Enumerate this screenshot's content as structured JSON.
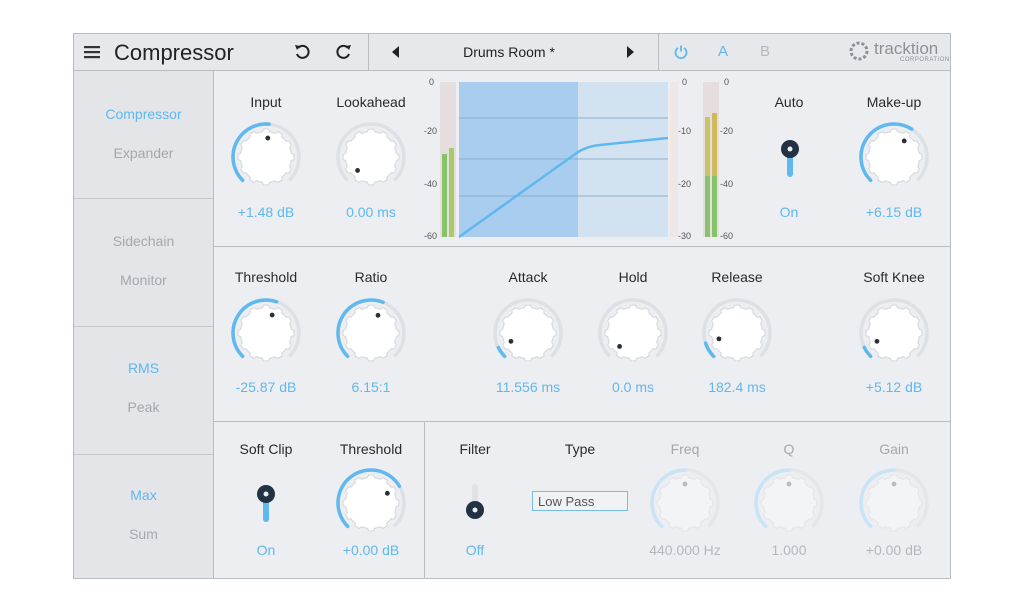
{
  "header": {
    "title": "Compressor",
    "preset": "Drums Room *",
    "ab_a": "A",
    "ab_b": "B",
    "brand": "tracktion",
    "brand_sub": "CORPORATION"
  },
  "sidebar": {
    "groups": [
      [
        {
          "label": "Compressor",
          "active": true
        },
        {
          "label": "Expander",
          "active": false
        }
      ],
      [
        {
          "label": "Sidechain",
          "active": false
        },
        {
          "label": "Monitor",
          "active": false
        }
      ],
      [
        {
          "label": "RMS",
          "active": true
        },
        {
          "label": "Peak",
          "active": false
        }
      ],
      [
        {
          "label": "Max",
          "active": true
        },
        {
          "label": "Sum",
          "active": false
        }
      ]
    ]
  },
  "top": {
    "input": {
      "label": "Input",
      "value": "+1.48 dB",
      "level": 0.52
    },
    "lookahead": {
      "label": "Lookahead",
      "value": "0.00 ms",
      "level": 0.0
    },
    "auto": {
      "label": "Auto",
      "value": "On"
    },
    "makeup": {
      "label": "Make-up",
      "value": "+6.15 dB",
      "level": 0.62
    }
  },
  "graph": {
    "left_scale": [
      "0",
      "-20",
      "-40",
      "-60"
    ],
    "right_scale": [
      "0",
      "-10",
      "-20",
      "-30"
    ],
    "out_scale": [
      "0",
      "-20",
      "-40",
      "-60"
    ]
  },
  "mid": {
    "threshold": {
      "label": "Threshold",
      "value": "-25.87 dB",
      "level": 0.57
    },
    "ratio": {
      "label": "Ratio",
      "value": "6.15:1",
      "level": 0.58
    },
    "attack": {
      "label": "Attack",
      "value": "11.556 ms",
      "level": 0.07
    },
    "hold": {
      "label": "Hold",
      "value": "0.0 ms",
      "level": 0.0
    },
    "release": {
      "label": "Release",
      "value": "182.4 ms",
      "level": 0.1
    },
    "softknee": {
      "label": "Soft Knee",
      "value": "+5.12 dB",
      "level": 0.07
    }
  },
  "bottom": {
    "softclip": {
      "label": "Soft Clip",
      "value": "On"
    },
    "threshold": {
      "label": "Threshold",
      "value": "+0.00 dB",
      "level": 0.72
    },
    "filter": {
      "label": "Filter",
      "value": "Off"
    },
    "type": {
      "label": "Type",
      "value": "Low Pass"
    },
    "freq": {
      "label": "Freq",
      "value": "440.000 Hz",
      "level": 0.5
    },
    "q": {
      "label": "Q",
      "value": "1.000",
      "level": 0.5
    },
    "gain": {
      "label": "Gain",
      "value": "+0.00 dB",
      "level": 0.5
    }
  },
  "colors": {
    "accent": "#5fb8ef",
    "panel": "#eceef1",
    "border": "#b9bcc1"
  }
}
